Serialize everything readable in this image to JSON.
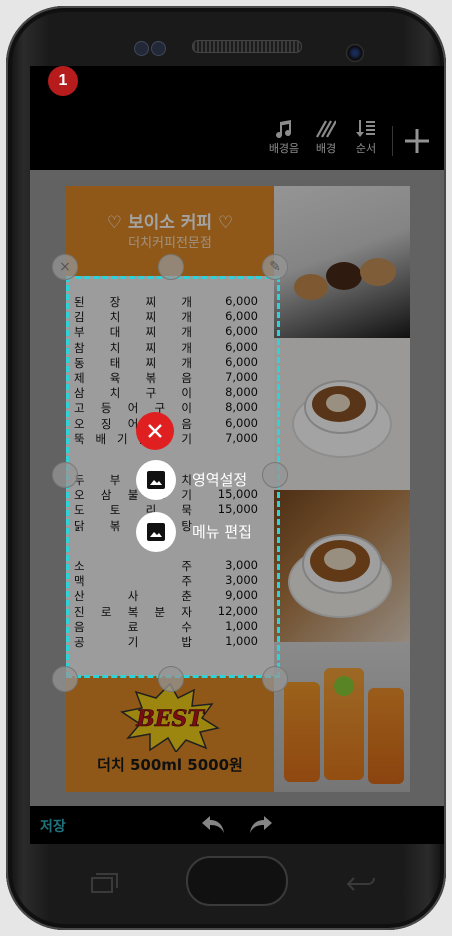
{
  "step_badge": "1",
  "toolbar": {
    "bgm_label": "배경음",
    "bg_label": "배경",
    "order_label": "순서"
  },
  "menu_card": {
    "title": "♡ 보이소 커피 ♡",
    "subtitle": "더치커피전문점",
    "group1": [
      {
        "name": "된장찌개",
        "price": "6,000"
      },
      {
        "name": "김치찌개",
        "price": "6,000"
      },
      {
        "name": "부대찌개",
        "price": "6,000"
      },
      {
        "name": "참치찌개",
        "price": "6,000"
      },
      {
        "name": "동태찌개",
        "price": "6,000"
      },
      {
        "name": "제육볶음",
        "price": "7,000"
      },
      {
        "name": "삼치구이",
        "price": "8,000"
      },
      {
        "name": "고등어구이",
        "price": "8,000"
      },
      {
        "name": "오징어볶음",
        "price": "6,000"
      },
      {
        "name": "뚝배기불고기",
        "price": "7,000"
      }
    ],
    "group2": [
      {
        "name": "두부김치",
        "price": ""
      },
      {
        "name": "오삼불고기",
        "price": "15,000"
      },
      {
        "name": "도토리묵",
        "price": "15,000"
      },
      {
        "name": "닭볶음탕",
        "price": ""
      }
    ],
    "group3": [
      {
        "name": "소주",
        "price": "3,000"
      },
      {
        "name": "맥주",
        "price": "3,000"
      },
      {
        "name": "산사춘",
        "price": "9,000"
      },
      {
        "name": "진로복분자",
        "price": "12,000"
      },
      {
        "name": "음료수",
        "price": "1,000"
      },
      {
        "name": "공기밥",
        "price": "1,000"
      }
    ],
    "best_text": "BEST",
    "promo": "더치 500ml  5000원"
  },
  "popup": {
    "area_setting": "영역설정",
    "menu_edit": "메뉴 편집"
  },
  "bottom": {
    "save_label": "저장"
  },
  "colors": {
    "accent": "#2ed3d8",
    "save": "#2fb5c2",
    "close": "#e02020",
    "orange": "#e08a26"
  }
}
